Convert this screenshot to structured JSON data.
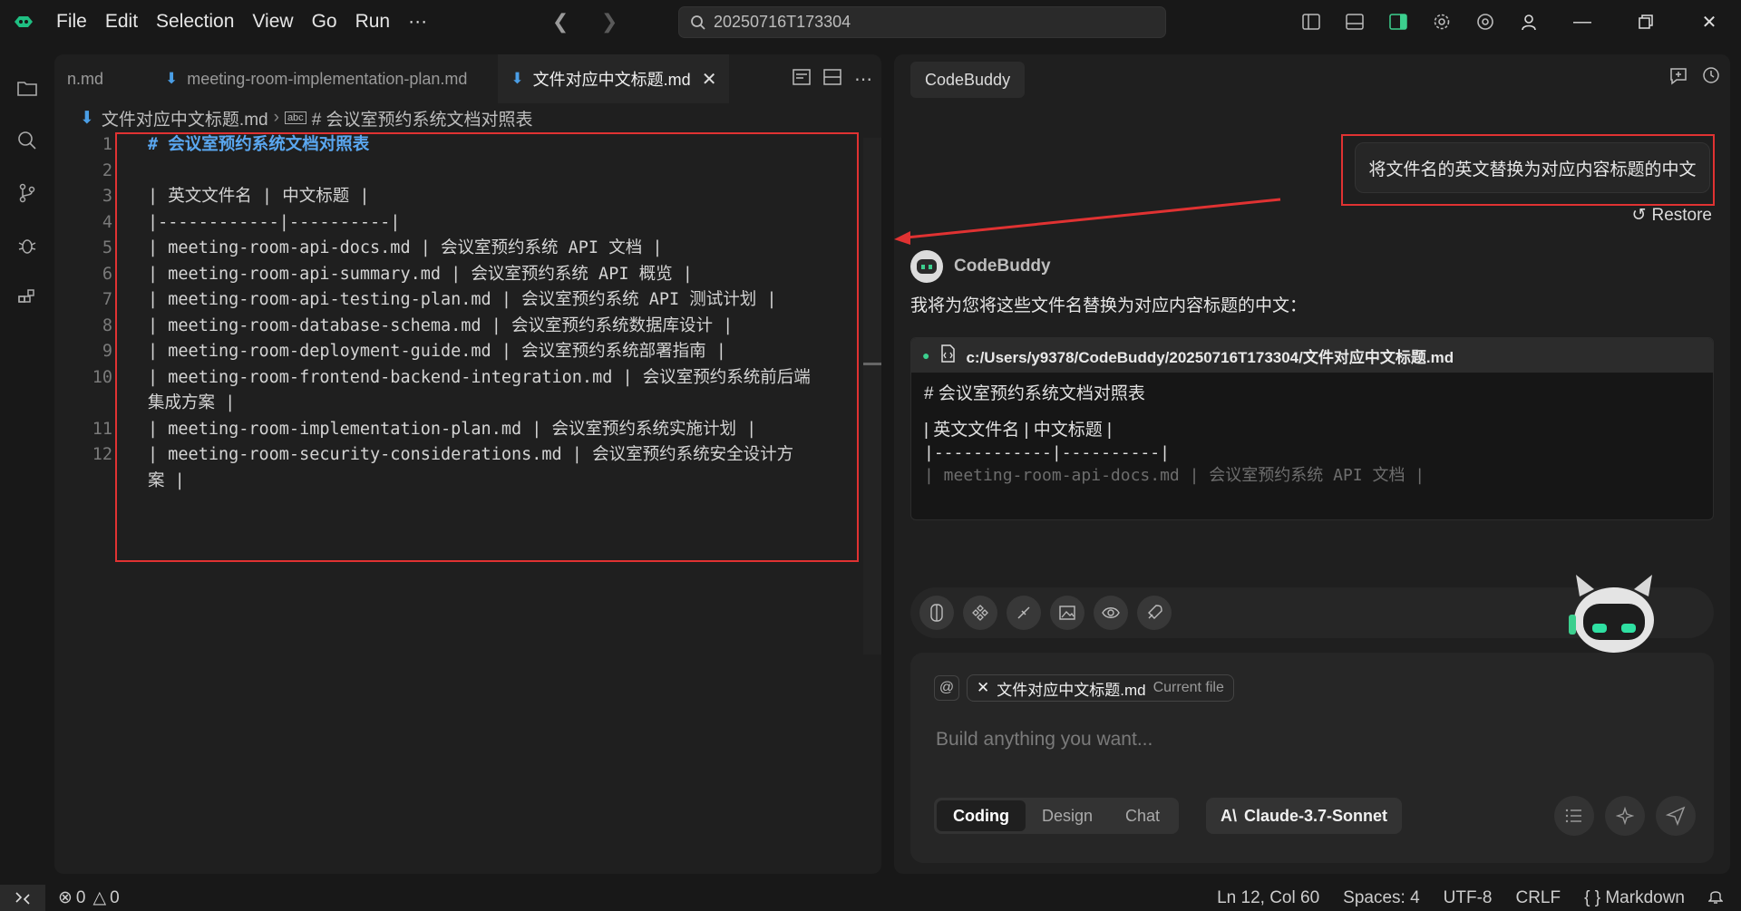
{
  "menu": {
    "items": [
      "File",
      "Edit",
      "Selection",
      "View",
      "Go",
      "Run",
      "···"
    ]
  },
  "search": {
    "text": "20250716T173304"
  },
  "tabs": [
    {
      "label": "n.md",
      "active": false
    },
    {
      "label": "meeting-room-implementation-plan.md",
      "active": false
    },
    {
      "label": "文件对应中文标题.md",
      "active": true
    }
  ],
  "breadcrumb": {
    "file": "文件对应中文标题.md",
    "section": "# 会议室预约系统文档对照表"
  },
  "code_lines": [
    {
      "n": "1",
      "text": "# 会议室预约系统文档对照表",
      "heading": true
    },
    {
      "n": "2",
      "text": ""
    },
    {
      "n": "3",
      "text": "| 英文文件名 | 中文标题 |"
    },
    {
      "n": "4",
      "text": "|------------|----------|"
    },
    {
      "n": "5",
      "text": "| meeting-room-api-docs.md | 会议室预约系统 API 文档 |"
    },
    {
      "n": "6",
      "text": "| meeting-room-api-summary.md | 会议室预约系统 API 概览 |"
    },
    {
      "n": "7",
      "text": "| meeting-room-api-testing-plan.md | 会议室预约系统 API 测试计划 |"
    },
    {
      "n": "8",
      "text": "| meeting-room-database-schema.md | 会议室预约系统数据库设计 |"
    },
    {
      "n": "9",
      "text": "| meeting-room-deployment-guide.md | 会议室预约系统部署指南 |"
    },
    {
      "n": "10",
      "text": "| meeting-room-frontend-backend-integration.md | 会议室预约系统前后端"
    },
    {
      "n": "",
      "text": "集成方案 |"
    },
    {
      "n": "11",
      "text": "| meeting-room-implementation-plan.md | 会议室预约系统实施计划 |"
    },
    {
      "n": "12",
      "text": "| meeting-room-security-considerations.md | 会议室预约系统安全设计方"
    },
    {
      "n": "",
      "text": "案 |"
    }
  ],
  "panel": {
    "tab_label": "CodeBuddy",
    "user_message": "将文件名的英文替换为对应内容标题的中文",
    "restore_label": "Restore",
    "bot_name": "CodeBuddy",
    "bot_reply": "我将为您将这些文件名替换为对应内容标题的中文：",
    "file_path": "c:/Users/y9378/CodeBuddy/20250716T173304/文件对应中文标题.md",
    "file_preview": [
      "# 会议室预约系统文档对照表",
      "| 英文文件名 | 中文标题 |",
      "|------------|----------|",
      "| meeting-room-api-docs.md | 会议室预约系统 API 文档 |"
    ],
    "context_chip": "文件对应中文标题.md",
    "context_chip_sub": "Current file",
    "input_placeholder": "Build anything you want...",
    "modes": [
      "Coding",
      "Design",
      "Chat"
    ],
    "model": "Claude-3.7-Sonnet"
  },
  "status": {
    "errors": "0",
    "warnings": "0",
    "position": "Ln 12, Col 60",
    "spaces": "Spaces: 4",
    "encoding": "UTF-8",
    "eol": "CRLF",
    "language": "Markdown"
  },
  "colors": {
    "accent_red": "#e03232",
    "heading_blue": "#5aa7f0",
    "md_icon_blue": "#4a9ee6",
    "status_green": "#3ccf8e"
  }
}
